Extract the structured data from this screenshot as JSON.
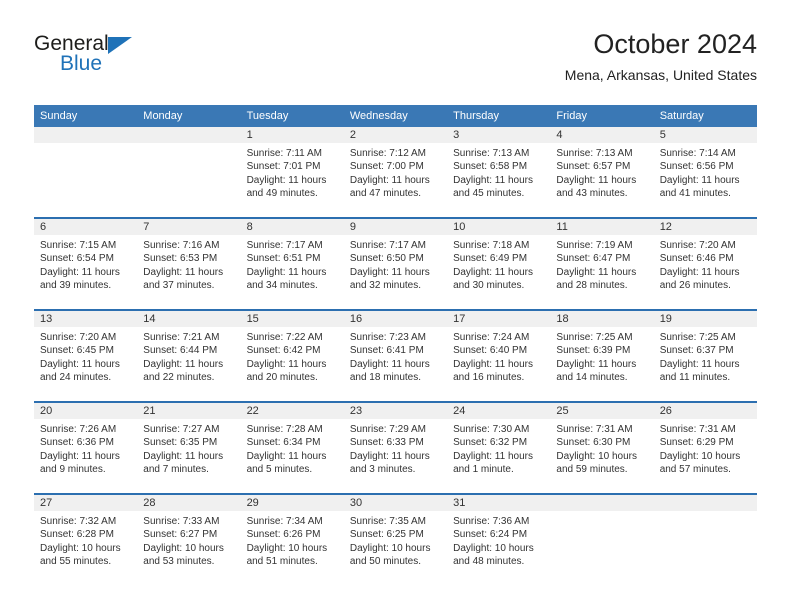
{
  "logo": {
    "word_one": "General",
    "word_two": "Blue",
    "triangle_icon": "blue-triangle-icon",
    "brand_color": "#1f72b8"
  },
  "header": {
    "title": "October 2024",
    "subtitle": "Mena, Arkansas, United States"
  },
  "calendar": {
    "header_bg": "#3a78b5",
    "divider_color": "#2c6fb0",
    "daynum_bg": "#f0f0f0",
    "weekday_headers": [
      "Sunday",
      "Monday",
      "Tuesday",
      "Wednesday",
      "Thursday",
      "Friday",
      "Saturday"
    ],
    "weeks": [
      [
        {
          "day": "",
          "lines": []
        },
        {
          "day": "",
          "lines": []
        },
        {
          "day": "1",
          "lines": [
            "Sunrise: 7:11 AM",
            "Sunset: 7:01 PM",
            "Daylight: 11 hours",
            "and 49 minutes."
          ]
        },
        {
          "day": "2",
          "lines": [
            "Sunrise: 7:12 AM",
            "Sunset: 7:00 PM",
            "Daylight: 11 hours",
            "and 47 minutes."
          ]
        },
        {
          "day": "3",
          "lines": [
            "Sunrise: 7:13 AM",
            "Sunset: 6:58 PM",
            "Daylight: 11 hours",
            "and 45 minutes."
          ]
        },
        {
          "day": "4",
          "lines": [
            "Sunrise: 7:13 AM",
            "Sunset: 6:57 PM",
            "Daylight: 11 hours",
            "and 43 minutes."
          ]
        },
        {
          "day": "5",
          "lines": [
            "Sunrise: 7:14 AM",
            "Sunset: 6:56 PM",
            "Daylight: 11 hours",
            "and 41 minutes."
          ]
        }
      ],
      [
        {
          "day": "6",
          "lines": [
            "Sunrise: 7:15 AM",
            "Sunset: 6:54 PM",
            "Daylight: 11 hours",
            "and 39 minutes."
          ]
        },
        {
          "day": "7",
          "lines": [
            "Sunrise: 7:16 AM",
            "Sunset: 6:53 PM",
            "Daylight: 11 hours",
            "and 37 minutes."
          ]
        },
        {
          "day": "8",
          "lines": [
            "Sunrise: 7:17 AM",
            "Sunset: 6:51 PM",
            "Daylight: 11 hours",
            "and 34 minutes."
          ]
        },
        {
          "day": "9",
          "lines": [
            "Sunrise: 7:17 AM",
            "Sunset: 6:50 PM",
            "Daylight: 11 hours",
            "and 32 minutes."
          ]
        },
        {
          "day": "10",
          "lines": [
            "Sunrise: 7:18 AM",
            "Sunset: 6:49 PM",
            "Daylight: 11 hours",
            "and 30 minutes."
          ]
        },
        {
          "day": "11",
          "lines": [
            "Sunrise: 7:19 AM",
            "Sunset: 6:47 PM",
            "Daylight: 11 hours",
            "and 28 minutes."
          ]
        },
        {
          "day": "12",
          "lines": [
            "Sunrise: 7:20 AM",
            "Sunset: 6:46 PM",
            "Daylight: 11 hours",
            "and 26 minutes."
          ]
        }
      ],
      [
        {
          "day": "13",
          "lines": [
            "Sunrise: 7:20 AM",
            "Sunset: 6:45 PM",
            "Daylight: 11 hours",
            "and 24 minutes."
          ]
        },
        {
          "day": "14",
          "lines": [
            "Sunrise: 7:21 AM",
            "Sunset: 6:44 PM",
            "Daylight: 11 hours",
            "and 22 minutes."
          ]
        },
        {
          "day": "15",
          "lines": [
            "Sunrise: 7:22 AM",
            "Sunset: 6:42 PM",
            "Daylight: 11 hours",
            "and 20 minutes."
          ]
        },
        {
          "day": "16",
          "lines": [
            "Sunrise: 7:23 AM",
            "Sunset: 6:41 PM",
            "Daylight: 11 hours",
            "and 18 minutes."
          ]
        },
        {
          "day": "17",
          "lines": [
            "Sunrise: 7:24 AM",
            "Sunset: 6:40 PM",
            "Daylight: 11 hours",
            "and 16 minutes."
          ]
        },
        {
          "day": "18",
          "lines": [
            "Sunrise: 7:25 AM",
            "Sunset: 6:39 PM",
            "Daylight: 11 hours",
            "and 14 minutes."
          ]
        },
        {
          "day": "19",
          "lines": [
            "Sunrise: 7:25 AM",
            "Sunset: 6:37 PM",
            "Daylight: 11 hours",
            "and 11 minutes."
          ]
        }
      ],
      [
        {
          "day": "20",
          "lines": [
            "Sunrise: 7:26 AM",
            "Sunset: 6:36 PM",
            "Daylight: 11 hours",
            "and 9 minutes."
          ]
        },
        {
          "day": "21",
          "lines": [
            "Sunrise: 7:27 AM",
            "Sunset: 6:35 PM",
            "Daylight: 11 hours",
            "and 7 minutes."
          ]
        },
        {
          "day": "22",
          "lines": [
            "Sunrise: 7:28 AM",
            "Sunset: 6:34 PM",
            "Daylight: 11 hours",
            "and 5 minutes."
          ]
        },
        {
          "day": "23",
          "lines": [
            "Sunrise: 7:29 AM",
            "Sunset: 6:33 PM",
            "Daylight: 11 hours",
            "and 3 minutes."
          ]
        },
        {
          "day": "24",
          "lines": [
            "Sunrise: 7:30 AM",
            "Sunset: 6:32 PM",
            "Daylight: 11 hours",
            "and 1 minute."
          ]
        },
        {
          "day": "25",
          "lines": [
            "Sunrise: 7:31 AM",
            "Sunset: 6:30 PM",
            "Daylight: 10 hours",
            "and 59 minutes."
          ]
        },
        {
          "day": "26",
          "lines": [
            "Sunrise: 7:31 AM",
            "Sunset: 6:29 PM",
            "Daylight: 10 hours",
            "and 57 minutes."
          ]
        }
      ],
      [
        {
          "day": "27",
          "lines": [
            "Sunrise: 7:32 AM",
            "Sunset: 6:28 PM",
            "Daylight: 10 hours",
            "and 55 minutes."
          ]
        },
        {
          "day": "28",
          "lines": [
            "Sunrise: 7:33 AM",
            "Sunset: 6:27 PM",
            "Daylight: 10 hours",
            "and 53 minutes."
          ]
        },
        {
          "day": "29",
          "lines": [
            "Sunrise: 7:34 AM",
            "Sunset: 6:26 PM",
            "Daylight: 10 hours",
            "and 51 minutes."
          ]
        },
        {
          "day": "30",
          "lines": [
            "Sunrise: 7:35 AM",
            "Sunset: 6:25 PM",
            "Daylight: 10 hours",
            "and 50 minutes."
          ]
        },
        {
          "day": "31",
          "lines": [
            "Sunrise: 7:36 AM",
            "Sunset: 6:24 PM",
            "Daylight: 10 hours",
            "and 48 minutes."
          ]
        },
        {
          "day": "",
          "lines": []
        },
        {
          "day": "",
          "lines": []
        }
      ]
    ]
  }
}
